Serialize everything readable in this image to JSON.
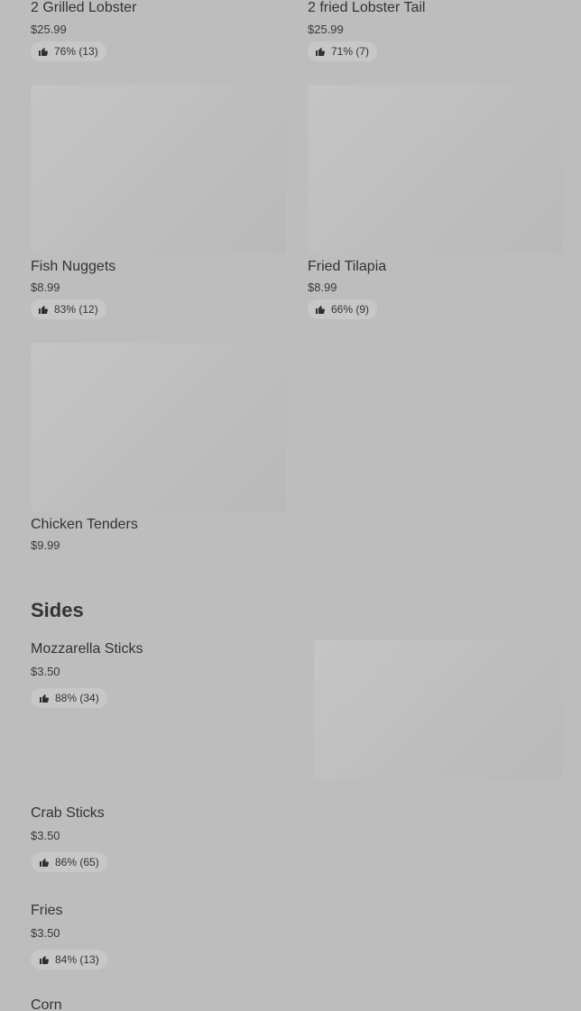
{
  "grid_items": [
    {
      "name": "2 Grilled Lobster",
      "price": "$25.99",
      "rating": "76% (13)"
    },
    {
      "name": "2 fried Lobster Tail",
      "price": "$25.99",
      "rating": "71% (7)"
    },
    {
      "name": "Fish Nuggets",
      "price": "$8.99",
      "rating": "83% (12)"
    },
    {
      "name": "Fried Tilapia",
      "price": "$8.99",
      "rating": "66% (9)"
    },
    {
      "name": "Chicken Tenders",
      "price": "$9.99"
    }
  ],
  "sides": {
    "title": "Sides",
    "items": [
      {
        "name": "Mozzarella Sticks",
        "price": "$3.50",
        "rating": "88% (34)"
      },
      {
        "name": "Crab Sticks",
        "price": "$3.50",
        "rating": "86% (65)"
      },
      {
        "name": "Fries",
        "price": "$3.50",
        "rating": "84% (13)"
      },
      {
        "name": "Corn"
      }
    ]
  },
  "icons": {
    "rating": "thumbs-up-icon"
  },
  "colors": {
    "overlay_background": "#bdbdbd",
    "badge_background": "#c7c7c7"
  }
}
